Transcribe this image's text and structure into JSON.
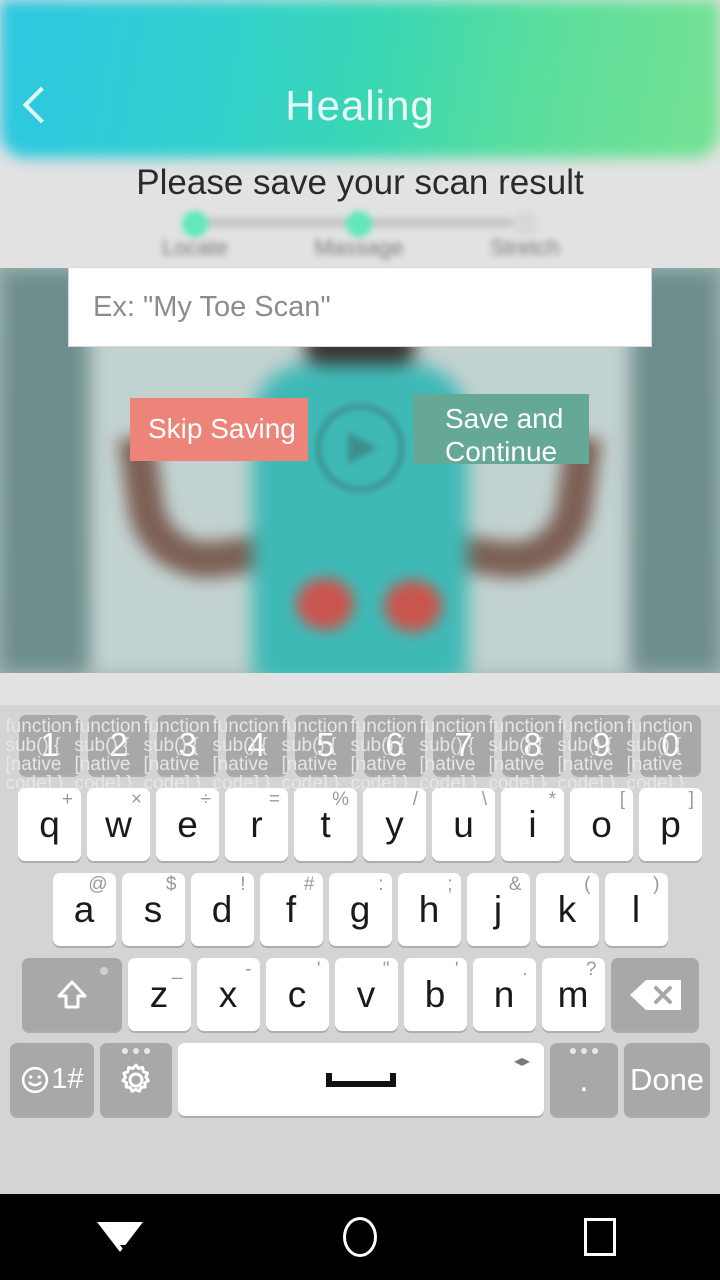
{
  "app": {
    "title": "Healing",
    "back_icon": "back-arrow-icon",
    "subtitle": "Please save your scan result"
  },
  "stepper": {
    "steps": [
      {
        "label": "Locate",
        "state": "done"
      },
      {
        "label": "Massage",
        "state": "done"
      },
      {
        "label": "Stretch",
        "state": "todo"
      }
    ],
    "done_color": "#5fe8b8",
    "todo_color": "#d8d8d8",
    "track_color": "#c4c4c4"
  },
  "dialog": {
    "input": {
      "value": "",
      "placeholder": "Ex: \"My Toe Scan\""
    },
    "skip_button": {
      "label": "Skip Saving",
      "color": "#ed8479"
    },
    "save_button": {
      "label": "Save and Continue",
      "color": "#64a895"
    }
  },
  "video": {
    "play_icon": "play-button-icon",
    "hotspot_color": "#e2453c"
  },
  "keyboard": {
    "number_row": [
      "1",
      "2",
      "3",
      "4",
      "5",
      "6",
      "7",
      "8",
      "9",
      "0"
    ],
    "row_q": [
      {
        "main": "q",
        "sub": "+"
      },
      {
        "main": "w",
        "sub": "×"
      },
      {
        "main": "e",
        "sub": "÷"
      },
      {
        "main": "r",
        "sub": "="
      },
      {
        "main": "t",
        "sub": "%"
      },
      {
        "main": "y",
        "sub": "/"
      },
      {
        "main": "u",
        "sub": "\\"
      },
      {
        "main": "i",
        "sub": "*"
      },
      {
        "main": "o",
        "sub": "["
      },
      {
        "main": "p",
        "sub": "]"
      }
    ],
    "row_a": [
      {
        "main": "a",
        "sub": "@"
      },
      {
        "main": "s",
        "sub": "$"
      },
      {
        "main": "d",
        "sub": "!"
      },
      {
        "main": "f",
        "sub": "#"
      },
      {
        "main": "g",
        "sub": ":"
      },
      {
        "main": "h",
        "sub": ";"
      },
      {
        "main": "j",
        "sub": "&"
      },
      {
        "main": "k",
        "sub": "("
      },
      {
        "main": "l",
        "sub": ")"
      }
    ],
    "row_z": [
      {
        "main": "z",
        "sub": "_"
      },
      {
        "main": "x",
        "sub": "-"
      },
      {
        "main": "c",
        "sub": "'"
      },
      {
        "main": "v",
        "sub": "\""
      },
      {
        "main": "b",
        "sub": "'"
      },
      {
        "main": "n",
        "sub": "."
      },
      {
        "main": "m",
        "sub": "?"
      }
    ],
    "shift_key": {
      "icon": "shift-arrow-icon"
    },
    "backspace_key": {
      "icon": "backspace-icon"
    },
    "symbols_key": {
      "label": "1#",
      "icon": "emoji-smiley-icon"
    },
    "settings_key": {
      "icon": "gear-icon"
    },
    "space_key": {
      "label": "",
      "icon": "spacebar-icon"
    },
    "period_key": {
      "label": "."
    },
    "done_key": {
      "label": "Done"
    }
  },
  "navbar": {
    "back": "nav-back-icon",
    "home": "nav-home-icon",
    "recents": "nav-recents-icon"
  }
}
